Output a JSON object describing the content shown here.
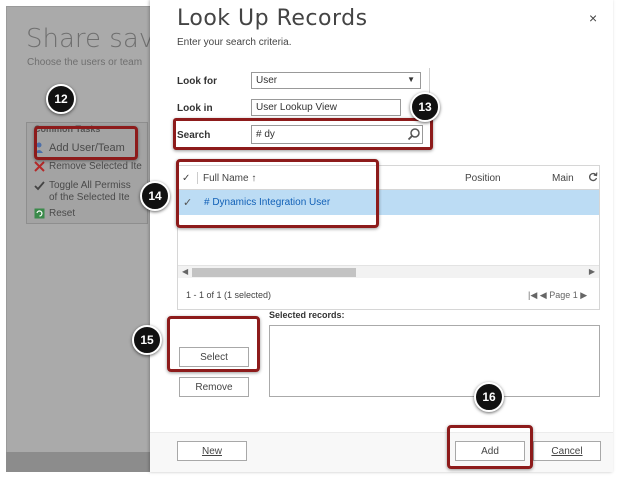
{
  "background_dialog": {
    "title": "Share saved",
    "subtitle": "Choose the users or team",
    "common_tasks_label": "Common Tasks",
    "tasks": [
      {
        "label": "Add User/Team",
        "icon": "add-user-icon"
      },
      {
        "label": "Remove Selected Ite",
        "icon": "remove-x-icon"
      },
      {
        "label": "Toggle All Permiss",
        "label2": "of the Selected Ite",
        "icon": "checkmark-icon"
      },
      {
        "label": "Reset",
        "icon": "reset-icon"
      }
    ]
  },
  "lookup_dialog": {
    "title": "Look Up Records",
    "subtitle": "Enter your search criteria.",
    "close_symbol": "×",
    "look_for_label": "Look for",
    "look_for_value": "User",
    "look_in_label": "Look in",
    "look_in_value": "User Lookup View",
    "search_label": "Search",
    "search_value": "# dy"
  },
  "grid": {
    "columns": [
      "Full Name ↑",
      "Position",
      "Main"
    ],
    "rows": [
      {
        "full_name": "# Dynamics Integration User",
        "selected": true
      }
    ],
    "status": "1 - 1 of 1 (1 selected)",
    "pager": "Page 1"
  },
  "selected_records_label": "Selected records:",
  "buttons": {
    "select": "Select",
    "remove": "Remove",
    "new": "New",
    "add": "Add",
    "cancel": "Cancel"
  },
  "annotations": {
    "badge_12": "12",
    "badge_13": "13",
    "badge_14": "14",
    "badge_15": "15",
    "badge_16": "16"
  },
  "colors": {
    "highlight": "#8d1b1b",
    "selected_row": "#bcdcf4",
    "link": "#1160b7"
  }
}
